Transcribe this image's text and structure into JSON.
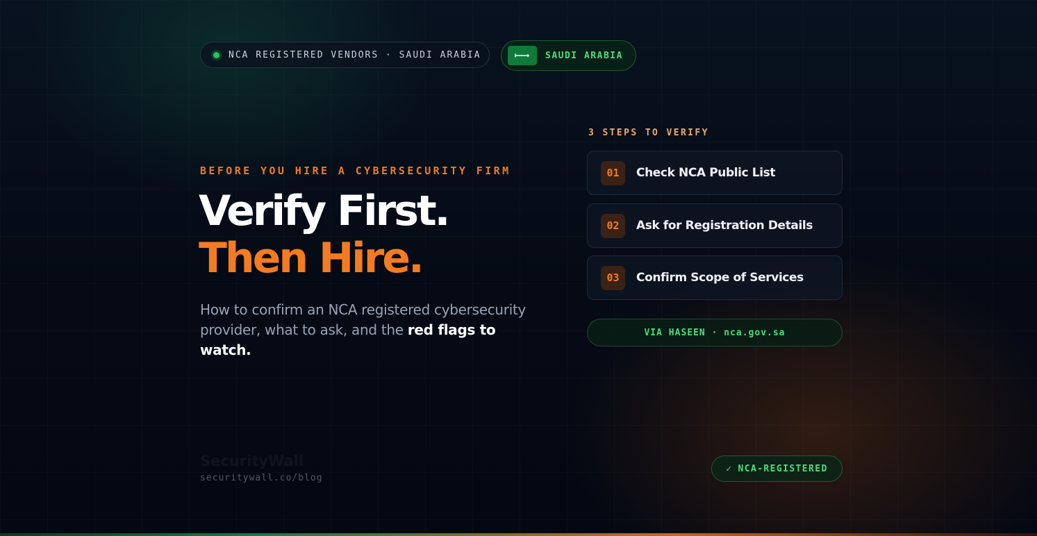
{
  "top": {
    "registry_pill": "NCA REGISTERED VENDORS · SAUDI ARABIA",
    "country_pill": "SAUDI ARABIA"
  },
  "hero": {
    "eyebrow": "BEFORE YOU HIRE A CYBERSECURITY FIRM",
    "headline_line1": "Verify First.",
    "headline_line2": "Then Hire.",
    "subtitle": "How to confirm an NCA registered cybersecurity provider, what to ask, and the ",
    "subtitle_emphasis": "red flags to watch."
  },
  "steps": {
    "heading": "3 STEPS TO VERIFY",
    "items": [
      {
        "num": "01",
        "label": "Check NCA Public List"
      },
      {
        "num": "02",
        "label": "Ask for Registration Details"
      },
      {
        "num": "03",
        "label": "Confirm Scope of Services"
      }
    ],
    "source": "VIA HASEEN · nca.gov.sa"
  },
  "footer": {
    "brand": "SecurityWall",
    "url": "securitywall.co/blog",
    "badge_check": "✓",
    "badge_label": "NCA-REGISTERED"
  },
  "colors": {
    "accent_orange": "#f47c20",
    "accent_green": "#4ade80",
    "background": "#050912",
    "flag_green": "#0f7a3a"
  },
  "icons": {
    "status_dot": "green-dot-icon",
    "flag": "saudi-flag-icon",
    "check": "check-icon"
  }
}
